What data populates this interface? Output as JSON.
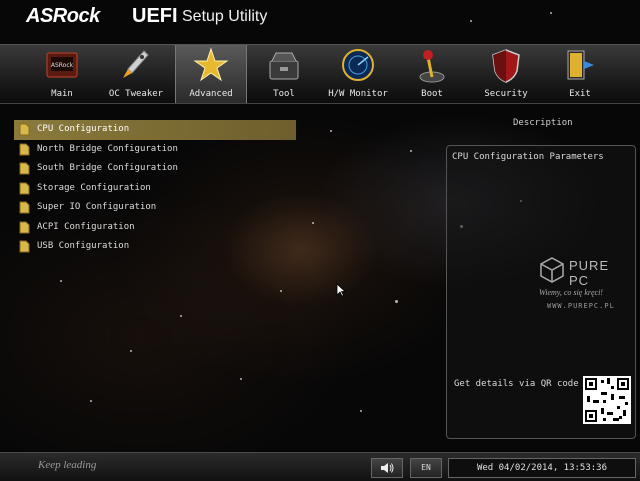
{
  "header": {
    "brand": "ASRock",
    "product": "UEFI",
    "subtitle": "Setup Utility"
  },
  "tabs": [
    {
      "label": "Main",
      "icon": "main-icon"
    },
    {
      "label": "OC Tweaker",
      "icon": "rocket-icon"
    },
    {
      "label": "Advanced",
      "icon": "star-icon",
      "active": true
    },
    {
      "label": "Tool",
      "icon": "toolbox-icon"
    },
    {
      "label": "H/W Monitor",
      "icon": "radar-icon"
    },
    {
      "label": "Boot",
      "icon": "joystick-icon"
    },
    {
      "label": "Security",
      "icon": "shield-icon"
    },
    {
      "label": "Exit",
      "icon": "exit-door-icon"
    }
  ],
  "menu": {
    "items": [
      {
        "label": "CPU Configuration",
        "selected": true
      },
      {
        "label": "North Bridge Configuration"
      },
      {
        "label": "South Bridge Configuration"
      },
      {
        "label": "Storage Configuration"
      },
      {
        "label": "Super IO Configuration"
      },
      {
        "label": "ACPI Configuration"
      },
      {
        "label": "USB Configuration"
      }
    ]
  },
  "description": {
    "title": "Description",
    "text": "CPU Configuration Parameters",
    "qr_label": "Get details via QR code"
  },
  "watermark": {
    "logo_text": "PURE PC",
    "slogan": "Wiemy, co się kręci!",
    "url": "WWW.PUREPC.PL"
  },
  "statusbar": {
    "slogan": "Keep leading",
    "language": "EN",
    "datetime": "Wed 04/02/2014, 13:53:36"
  },
  "colors": {
    "accent_gold": "#8a7a3c",
    "folder_yellow": "#d8b84a"
  }
}
